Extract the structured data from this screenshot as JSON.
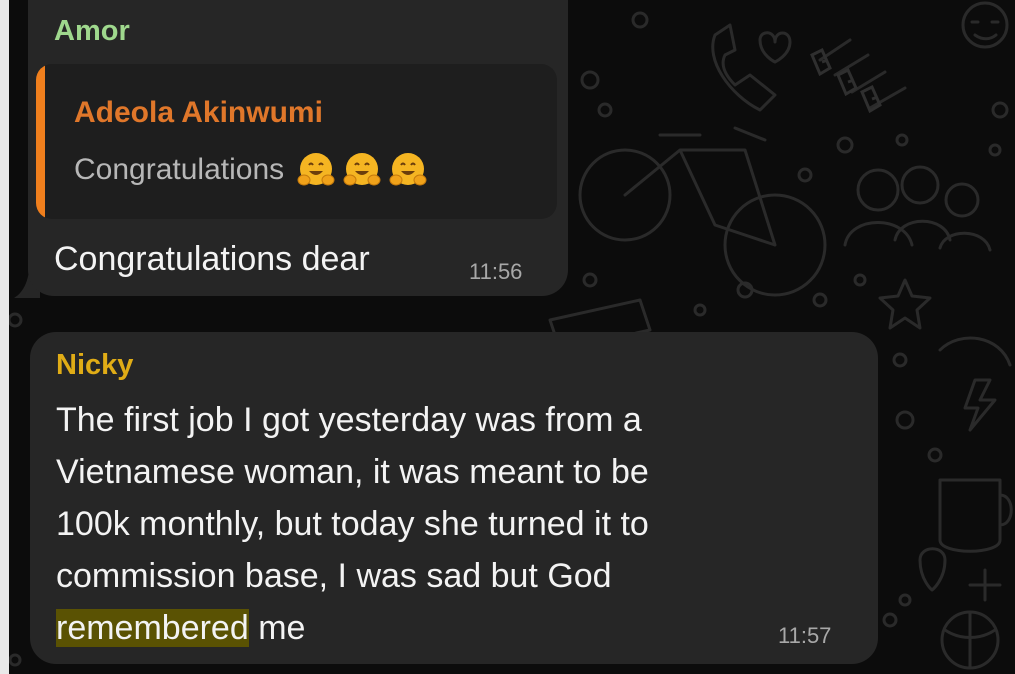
{
  "chat": {
    "background_color": "#0c0c0c",
    "bubble_color": "#262626",
    "messages": [
      {
        "sender": "Amor",
        "sender_color": "#9fd88d",
        "reply": {
          "author": "Adeola Akinwumi",
          "author_color": "#e0772a",
          "text": "Congratulations",
          "emojis": [
            "smiling-face-with-open-hands-icon",
            "smiling-face-with-open-hands-icon",
            "smiling-face-with-open-hands-icon"
          ],
          "accent_bar_color": "#f07f1d"
        },
        "text": "Congratulations dear",
        "time": "11:56"
      },
      {
        "sender": "Nicky",
        "sender_color": "#e0ac16",
        "text_lines": [
          "The first job I got yesterday was from a",
          "Vietnamese woman, it was meant to be",
          "100k monthly, but today she turned it to",
          "commission base, I was sad but God"
        ],
        "last_line_highlighted": "remembered",
        "last_line_rest": " me",
        "highlight_color": "#5a5203",
        "time": "11:57"
      }
    ]
  }
}
